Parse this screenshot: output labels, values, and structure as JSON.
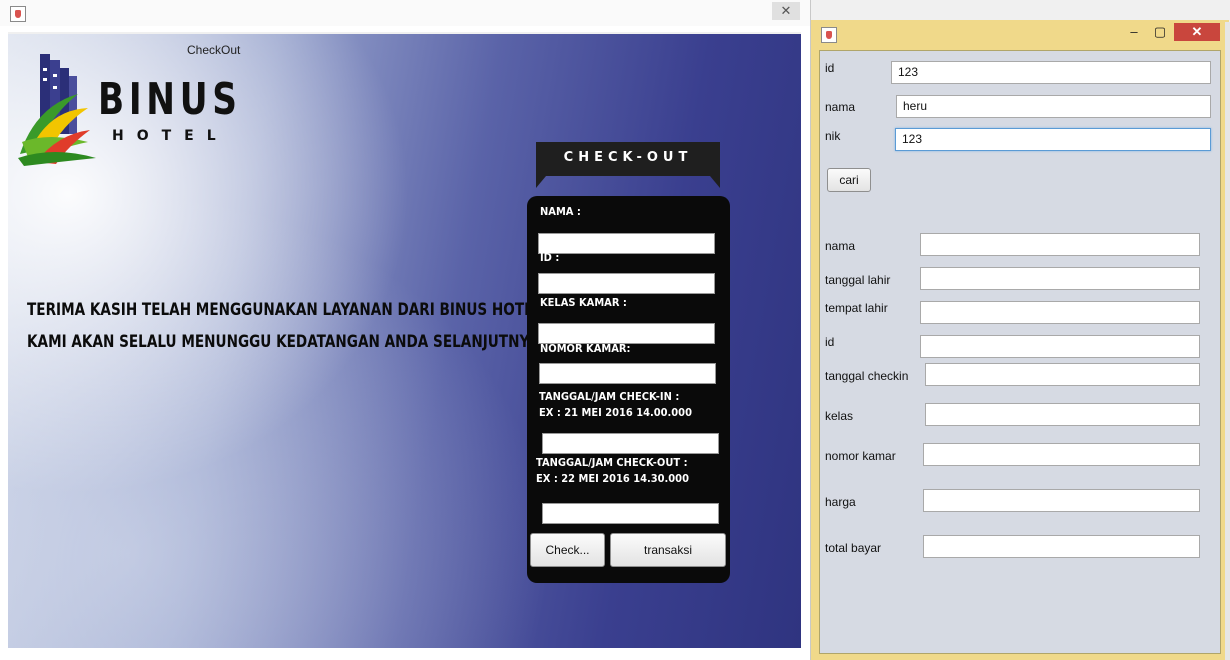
{
  "left_window": {
    "top_label": "CheckOut",
    "logo": {
      "name": "BINUS",
      "subtitle": "HOTEL"
    },
    "message": {
      "line1": "TERIMA KASIH TELAH MENGGUNAKAN LAYANAN DARI BINUS HOTEL",
      "line2": "KAMI AKAN SELALU MENUNGGU KEDATANGAN ANDA SELANJUTNYA"
    },
    "panel": {
      "title": "CHECK-OUT",
      "nama_label": "NAMA :",
      "id_label": "ID       :",
      "kelas_label": "KELAS KAMAR :",
      "nomor_label": "NOMOR KAMAR:",
      "checkin_label": "TANGGAL/JAM CHECK-IN   :",
      "checkin_example": "EX : 21 MEI 2016 14.00.000",
      "checkout_label": "TANGGAL/JAM CHECK-OUT   :",
      "checkout_example": "EX : 22 MEI 2016 14.30.000",
      "check_button": "Check...",
      "transaksi_button": "transaksi"
    }
  },
  "right_window": {
    "search": {
      "id_label": "id",
      "id_value": "123",
      "nama_label": "nama",
      "nama_value": "heru",
      "nik_label": "nik",
      "nik_value": "123",
      "cari_button": "cari"
    },
    "fields": [
      {
        "label": "nama",
        "value": ""
      },
      {
        "label": "tanggal lahir",
        "value": ""
      },
      {
        "label": "tempat lahir",
        "value": ""
      },
      {
        "label": "id",
        "value": ""
      },
      {
        "label": "tanggal checkin",
        "value": ""
      },
      {
        "label": "kelas",
        "value": ""
      },
      {
        "label": "nomor kamar",
        "value": ""
      },
      {
        "label": "harga",
        "value": ""
      },
      {
        "label": "total bayar",
        "value": ""
      }
    ]
  },
  "colors": {
    "panel_bg": "#0a0a0a",
    "right_window_frame": "#f0d98a",
    "close_red": "#c9463d",
    "focus_blue": "#5b9bd5"
  }
}
